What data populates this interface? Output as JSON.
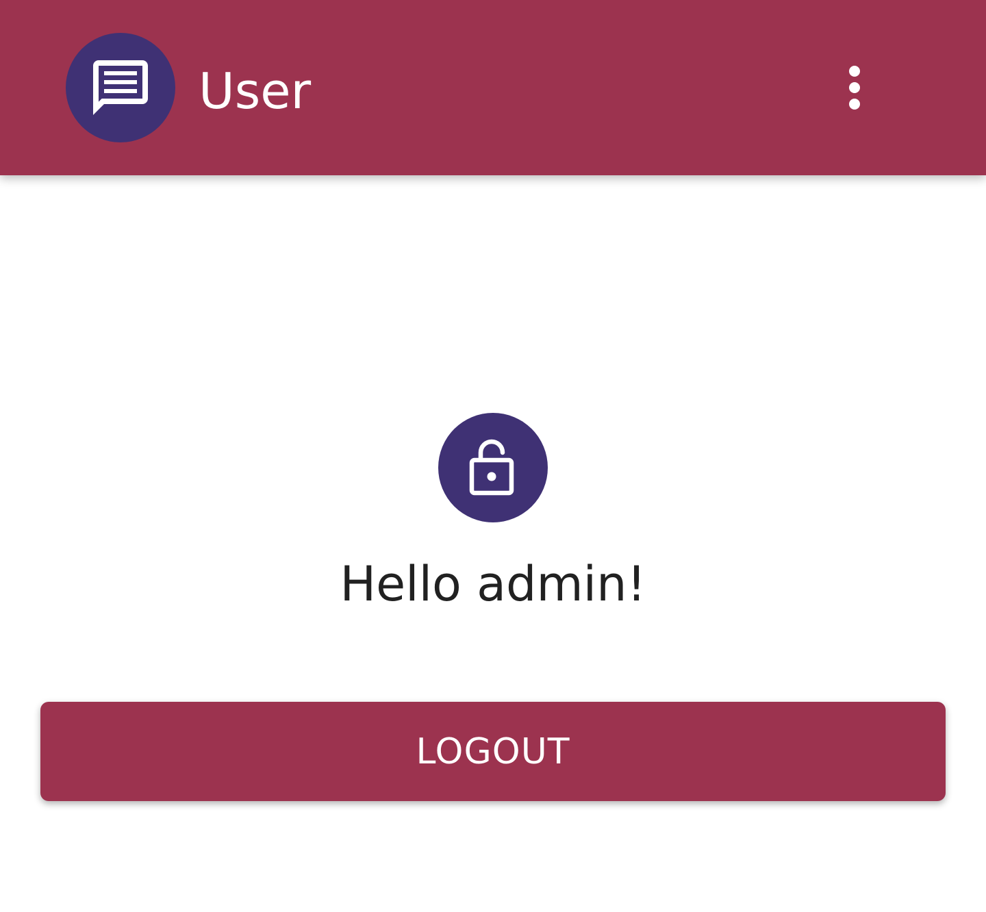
{
  "colors": {
    "primary": "#9c334f",
    "accent": "#3f3174",
    "background": "#ffffff",
    "text": "#212121",
    "on_primary": "#ffffff"
  },
  "app_bar": {
    "icon": "chat-message-icon",
    "title": "User",
    "overflow_icon": "more-vert-icon"
  },
  "main": {
    "status_icon": "lock-open-icon",
    "greeting": "Hello admin!",
    "logout_label": "LOGOUT"
  }
}
